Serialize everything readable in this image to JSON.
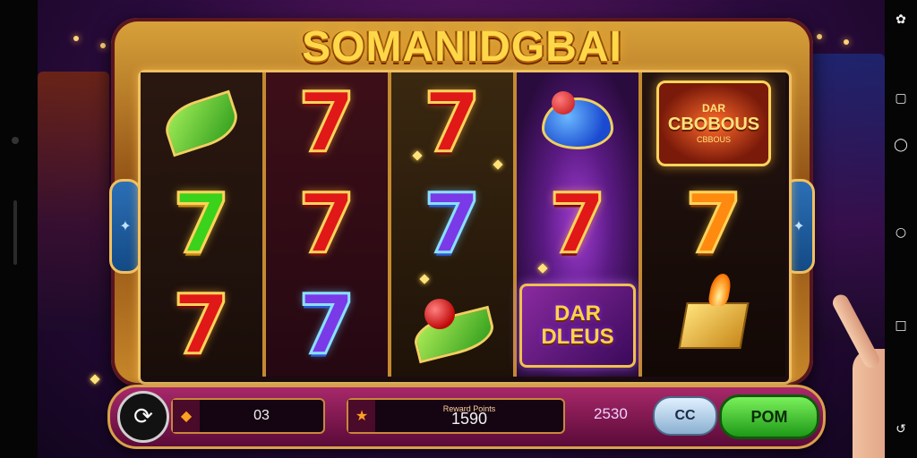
{
  "game": {
    "title": "SOMANIDGBAI"
  },
  "reels": {
    "bonus_badge": {
      "line1": "DAR",
      "line2": "CBOBOUS",
      "line3": "CBBOUS"
    },
    "deluxe_badge": {
      "line1": "DAR",
      "line2": "DLEUS"
    }
  },
  "bottom_bar": {
    "bet_value": "03",
    "win_label": "Reward Points",
    "win_value": "1590",
    "credit_value": "2530",
    "small_button_label": "CC",
    "play_button_label": "POM"
  },
  "icons": {
    "spin": "spin-icon",
    "coin": "coin-icon",
    "nav": [
      "gallery-icon",
      "back-square-icon",
      "chat-icon",
      "home-circle-icon",
      "recent-icon",
      "undo-icon"
    ]
  },
  "colors": {
    "accent_gold": "#ffd84a",
    "play_green": "#3ac828",
    "bar_magenta": "#a8286a"
  }
}
